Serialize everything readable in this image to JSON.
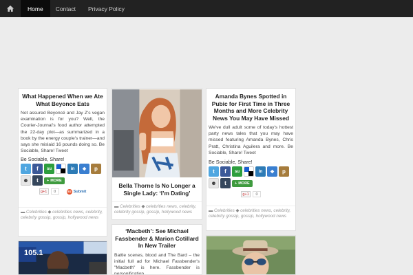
{
  "nav": {
    "items": [
      {
        "label": "Home",
        "active": true
      },
      {
        "label": "Contact",
        "active": false
      },
      {
        "label": "Privacy Policy",
        "active": false
      }
    ]
  },
  "posts": {
    "beyonce": {
      "title": "What Happened When we Ate What Beyonce Eats",
      "excerpt": "Not assured Beyoncé and Jay Z's vegan examination is for you? Well, the Courier-Journal's food author attempted the 22-day plot—as summarized in a book by the energy couple's trainer—and says she mislaid 16 pounds doing so. Be Sociable, Share! Tweet",
      "sociable": "Be Sociable, Share!",
      "more": "MORE",
      "gcount": "0",
      "submit": "Submit",
      "cat_prefix": "Celebrities",
      "tags": "celebrities news, celebrity, celebrity gossip, gossip, hollywood news"
    },
    "bella": {
      "title": "Bella Thorne Is No Longer a Single Lady: ‘I’m Dating’",
      "cat_prefix": "Celebrities",
      "tags": "celebrities news, celebrity, celebrity gossip, gossip, hollywood news"
    },
    "macbeth": {
      "title": "‘Macbeth’: See Michael Fassbender & Marion Cotillard In New Trailer",
      "excerpt": "Battle scenes, blood and The Bard – the initial full ad for Michael Fassbender's \"Macbeth\" is here. Fassbender is personification"
    },
    "amanda": {
      "title": "Amanda Bynes Spotted in Pubic for First Time in Three Months and More Celebrity News You May Have Missed",
      "excerpt": "We've dull adult some of today's hottest party news tales that you may have missed featuring Amanda Bynes, Chris Pratt, Christina Aguilera and more. Be Sociable, Share! Tweet",
      "sociable": "Be Sociable, Share!",
      "more": "MORE",
      "gcount": "0",
      "cat_prefix": "Celebrities",
      "tags": "celebrities news, celebrity, celebrity gossip, gossip, hollywood news"
    },
    "radio": {
      "sign": "105.1"
    }
  },
  "share_icons": [
    {
      "name": "twitter-icon",
      "glyph": "t",
      "color": "#4fa6e0"
    },
    {
      "name": "facebook-icon",
      "glyph": "f",
      "color": "#3b5998"
    },
    {
      "name": "stumbleupon-icon",
      "glyph": "su",
      "color": "#2e9e3e"
    },
    {
      "name": "delicious-icon",
      "glyph": "",
      "color": "#1a5fd1"
    },
    {
      "name": "linkedin-icon",
      "glyph": "in",
      "color": "#2d7bb6"
    },
    {
      "name": "myspace-icon",
      "glyph": "❖",
      "color": "#3a7fd0"
    },
    {
      "name": "plurk-icon",
      "glyph": "p",
      "color": "#a67c3c"
    },
    {
      "name": "reddit-icon",
      "glyph": "☻",
      "color": "#e6e6e6"
    },
    {
      "name": "tumblr-icon",
      "glyph": "t",
      "color": "#35465c"
    }
  ]
}
